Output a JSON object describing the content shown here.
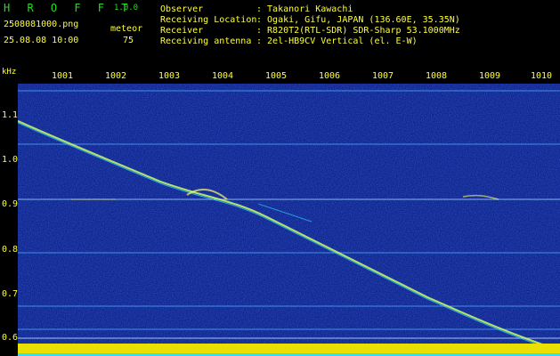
{
  "header": {
    "app_name": "H R O F F T",
    "version": "1.0.0",
    "filename": "2508081000.png",
    "datetime": "25.08.08 10:00",
    "meteor_label": "meteor",
    "meteor_count": "75",
    "observer_label": "Observer",
    "observer_value": ": Takanori Kawachi",
    "location_label": "Receiving Location",
    "location_value": ": Ogaki, Gifu, JAPAN (136.60E, 35.35N)",
    "receiver_label": "Receiver",
    "receiver_value": ": R820T2(RTL-SDR) SDR-Sharp 53.1000MHz",
    "antenna_label": "Receiving antenna",
    "antenna_value": ": 2el-HB9CV Vertical (el. E-W)"
  },
  "axis": {
    "unit": "kHz",
    "time_ticks": [
      "1001",
      "1002",
      "1003",
      "1004",
      "1005",
      "1006",
      "1007",
      "1008",
      "1009",
      "1010"
    ],
    "freq_ticks": [
      "1.1",
      "1.0",
      "0.9",
      "0.8",
      "0.7",
      "0.6"
    ]
  },
  "colors": {
    "text": "#ffff33",
    "title": "#22dd22",
    "background": "#00107a",
    "signal": "#ccff66"
  }
}
